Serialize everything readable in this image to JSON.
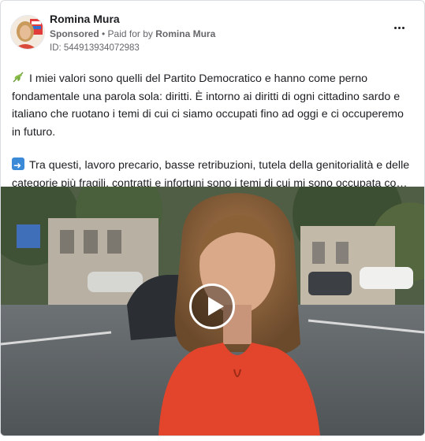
{
  "post": {
    "author": "Romina Mura",
    "sponsored_label": "Sponsored",
    "separator": " • ",
    "paid_for_label": "Paid for by",
    "paid_for_name": "Romina Mura",
    "ad_id": "ID: 544913934072983",
    "icons": {
      "menu": "more-horizontal-icon",
      "leaf": "herb-emoji",
      "arrow": "right-arrow-emoji",
      "play": "play-icon"
    }
  },
  "body": {
    "paragraph_1": "I miei valori sono quelli del Partito Democratico e hanno come perno fondamentale una parola sola: diritti. È intorno ai diritti di ogni cittadino sardo e italiano che ruotano i temi di cui ci siamo occupati fino ad oggi e ci occuperemo in futuro.",
    "paragraph_2_line_1": "Tra questi, lavoro precario, basse retribuzioni, tutela della genitorialità e delle",
    "paragraph_2_line_2": "categorie più fragili, contratti e infortuni sono i temi di cui mi sono occupata com..."
  },
  "colors": {
    "text": "#1c1e21",
    "secondary": "#65676b",
    "border": "#dadde1",
    "dress": "#e2452b"
  }
}
